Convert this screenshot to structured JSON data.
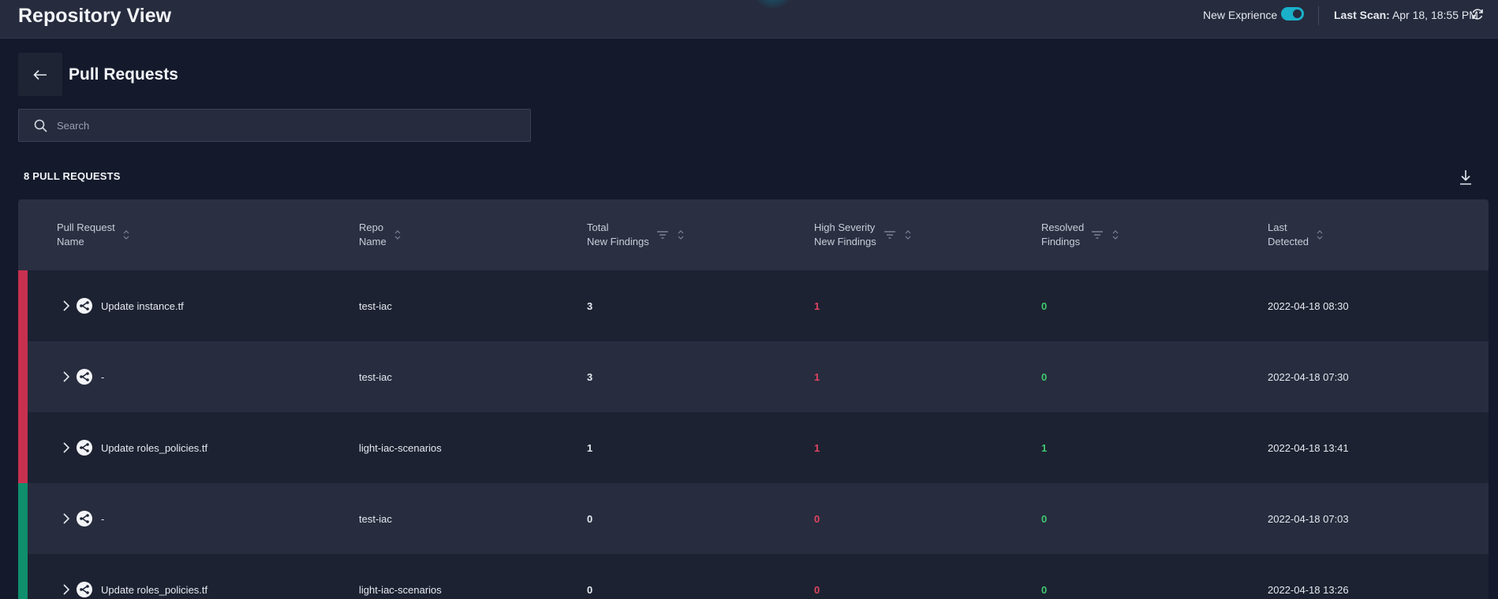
{
  "header": {
    "title": "Repository View",
    "new_experience_label": "New Exprience",
    "new_experience_on": true,
    "last_scan_key": "Last Scan:",
    "last_scan_value": "Apr 18, 18:55 PM"
  },
  "page": {
    "title": "Pull Requests"
  },
  "search": {
    "placeholder": "Search",
    "value": ""
  },
  "summary": {
    "count_label": "8 PULL REQUESTS"
  },
  "table": {
    "columns": [
      {
        "label": "Pull Request\nName",
        "filter": false
      },
      {
        "label": "Repo\nName",
        "filter": false
      },
      {
        "label": "Total\nNew Findings",
        "filter": true
      },
      {
        "label": "High Severity\nNew Findings",
        "filter": true
      },
      {
        "label": "Resolved\nFindings",
        "filter": true
      },
      {
        "label": "Last\nDetected",
        "filter": false
      }
    ],
    "rows": [
      {
        "name": "Update instance.tf",
        "repo": "test-iac",
        "total": "3",
        "high": "1",
        "resolved": "0",
        "last": "2022-04-18 08:30",
        "status": "red"
      },
      {
        "name": "-",
        "repo": "test-iac",
        "total": "3",
        "high": "1",
        "resolved": "0",
        "last": "2022-04-18 07:30",
        "status": "red"
      },
      {
        "name": "Update roles_policies.tf",
        "repo": "light-iac-scenarios",
        "total": "1",
        "high": "1",
        "resolved": "1",
        "last": "2022-04-18 13:41",
        "status": "red"
      },
      {
        "name": "-",
        "repo": "test-iac",
        "total": "0",
        "high": "0",
        "resolved": "0",
        "last": "2022-04-18 07:03",
        "status": "green"
      },
      {
        "name": "Update roles_policies.tf",
        "repo": "light-iac-scenarios",
        "total": "0",
        "high": "0",
        "resolved": "0",
        "last": "2022-04-18 13:26",
        "status": "green"
      }
    ]
  },
  "colors": {
    "accent": "#1ab0c9",
    "status_red": "#c8304f",
    "status_green": "#0f8f6c",
    "value_red": "#e0455f",
    "value_green": "#3fc96e"
  },
  "icons": {
    "back": "arrow-left-icon",
    "search": "search-icon",
    "download": "download-icon",
    "refresh": "refresh-icon",
    "sort": "sort-icon",
    "filter": "filter-icon",
    "expand": "chevron-right-icon",
    "pull_request": "pull-request-icon"
  }
}
